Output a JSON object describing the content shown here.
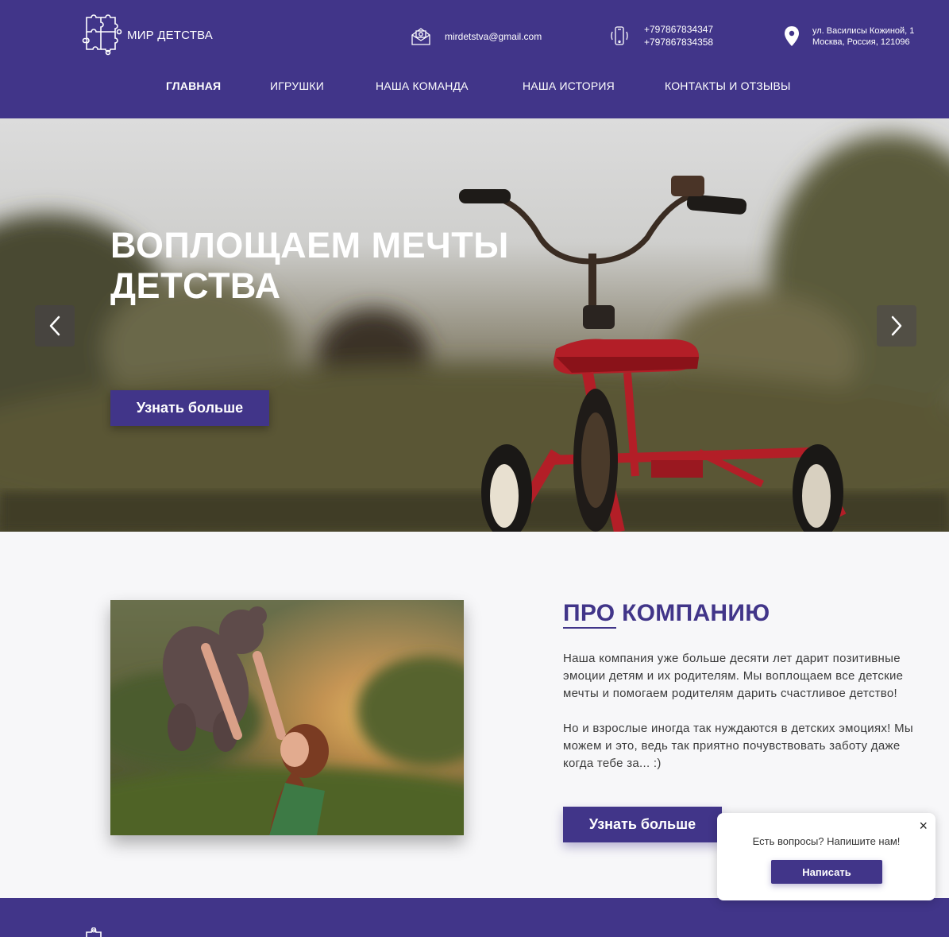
{
  "brand": {
    "name": "МИР ДЕТСТВА",
    "logo_icon": "puzzle-icon"
  },
  "contacts": {
    "email": "mirdetstva@gmail.com",
    "phones": [
      "+797867834347",
      "+797867834358"
    ],
    "address": [
      "ул. Василисы Кожиной, 1",
      "Москва, Россия, 121096"
    ]
  },
  "nav": {
    "items": [
      {
        "label": "ГЛАВНАЯ",
        "active": true
      },
      {
        "label": "ИГРУШКИ",
        "active": false
      },
      {
        "label": "НАША КОМАНДА",
        "active": false
      },
      {
        "label": "НАША ИСТОРИЯ",
        "active": false
      },
      {
        "label": "КОНТАКТЫ И ОТЗЫВЫ",
        "active": false
      }
    ]
  },
  "hero": {
    "title_line1": "ВОПЛОЩАЕМ МЕЧТЫ",
    "title_line2": "ДЕТСТВА",
    "button_label": "Узнать больше"
  },
  "about": {
    "title_part1": "ПРО",
    "title_part2": "КОМПАНИЮ",
    "paragraph1": "Наша компания уже больше десяти лет дарит позитивные эмоции детям и их родителям. Мы воплощаем все детские мечты и помогаем родителям дарить счастливое детство!",
    "paragraph2": "Но и взрослые иногда так нуждаются в детских эмоциях! Мы можем и это, ведь так приятно почувствовать заботу даже когда тебе за... :)",
    "button_label": "Узнать больше"
  },
  "chat": {
    "close_label": "×",
    "text": "Есть вопросы? Напишите нам!",
    "button_label": "Написать"
  },
  "colors": {
    "brand": "#413589",
    "hero_button": "#413589",
    "background": "#f7f7f9"
  }
}
